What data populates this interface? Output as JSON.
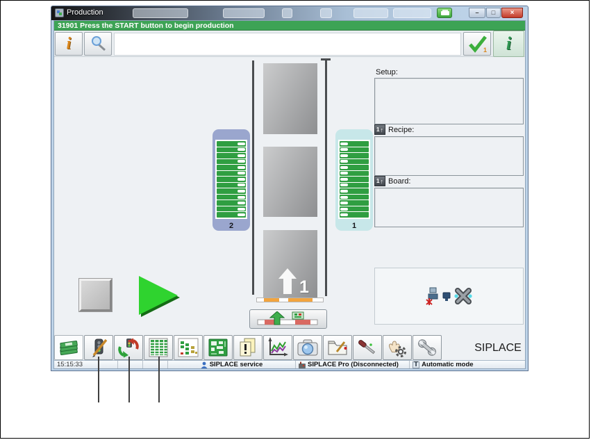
{
  "window": {
    "title": "Production",
    "message": "31901 Press the START button to begin production",
    "min_glyph": "–",
    "max_glyph": "□",
    "close_glyph": "×"
  },
  "top_toolbar": {
    "info_glyph": "i",
    "confirm_badge": "1",
    "help_glyph": "i"
  },
  "machine": {
    "left_bank_label": "2",
    "right_bank_label": "1",
    "slot_count": 13,
    "board_arrow_label": "1"
  },
  "right_panel": {
    "setup_label": "Setup:",
    "recipe_label": "Recipe:",
    "board_label": "Board:",
    "tag_number": "1",
    "tag_arrow": "↑"
  },
  "bottom_toolbar": {
    "brand": "SIPLACE",
    "icons": [
      "boards-stack",
      "traffic-light-edit",
      "traffic-light-refresh",
      "feeder-table",
      "component-status",
      "pcb-view",
      "messages",
      "statistics",
      "camera",
      "folder-edit",
      "screwdriver",
      "manual-operations",
      "wrench"
    ]
  },
  "status_bar": {
    "time": "15:15:33",
    "service": "SIPLACE service",
    "connection": "SIPLACE Pro (Disconnected)",
    "mode": "Automatic mode",
    "mode_glyph": "T"
  },
  "colors": {
    "message_green": "#3da355",
    "feeder_green": "#2f9e41",
    "bank_left": "#9aa6ce",
    "bank_right": "#c7e7e9",
    "conveyor_orange": "#f2a43e",
    "start_green": "#2fd32f"
  }
}
